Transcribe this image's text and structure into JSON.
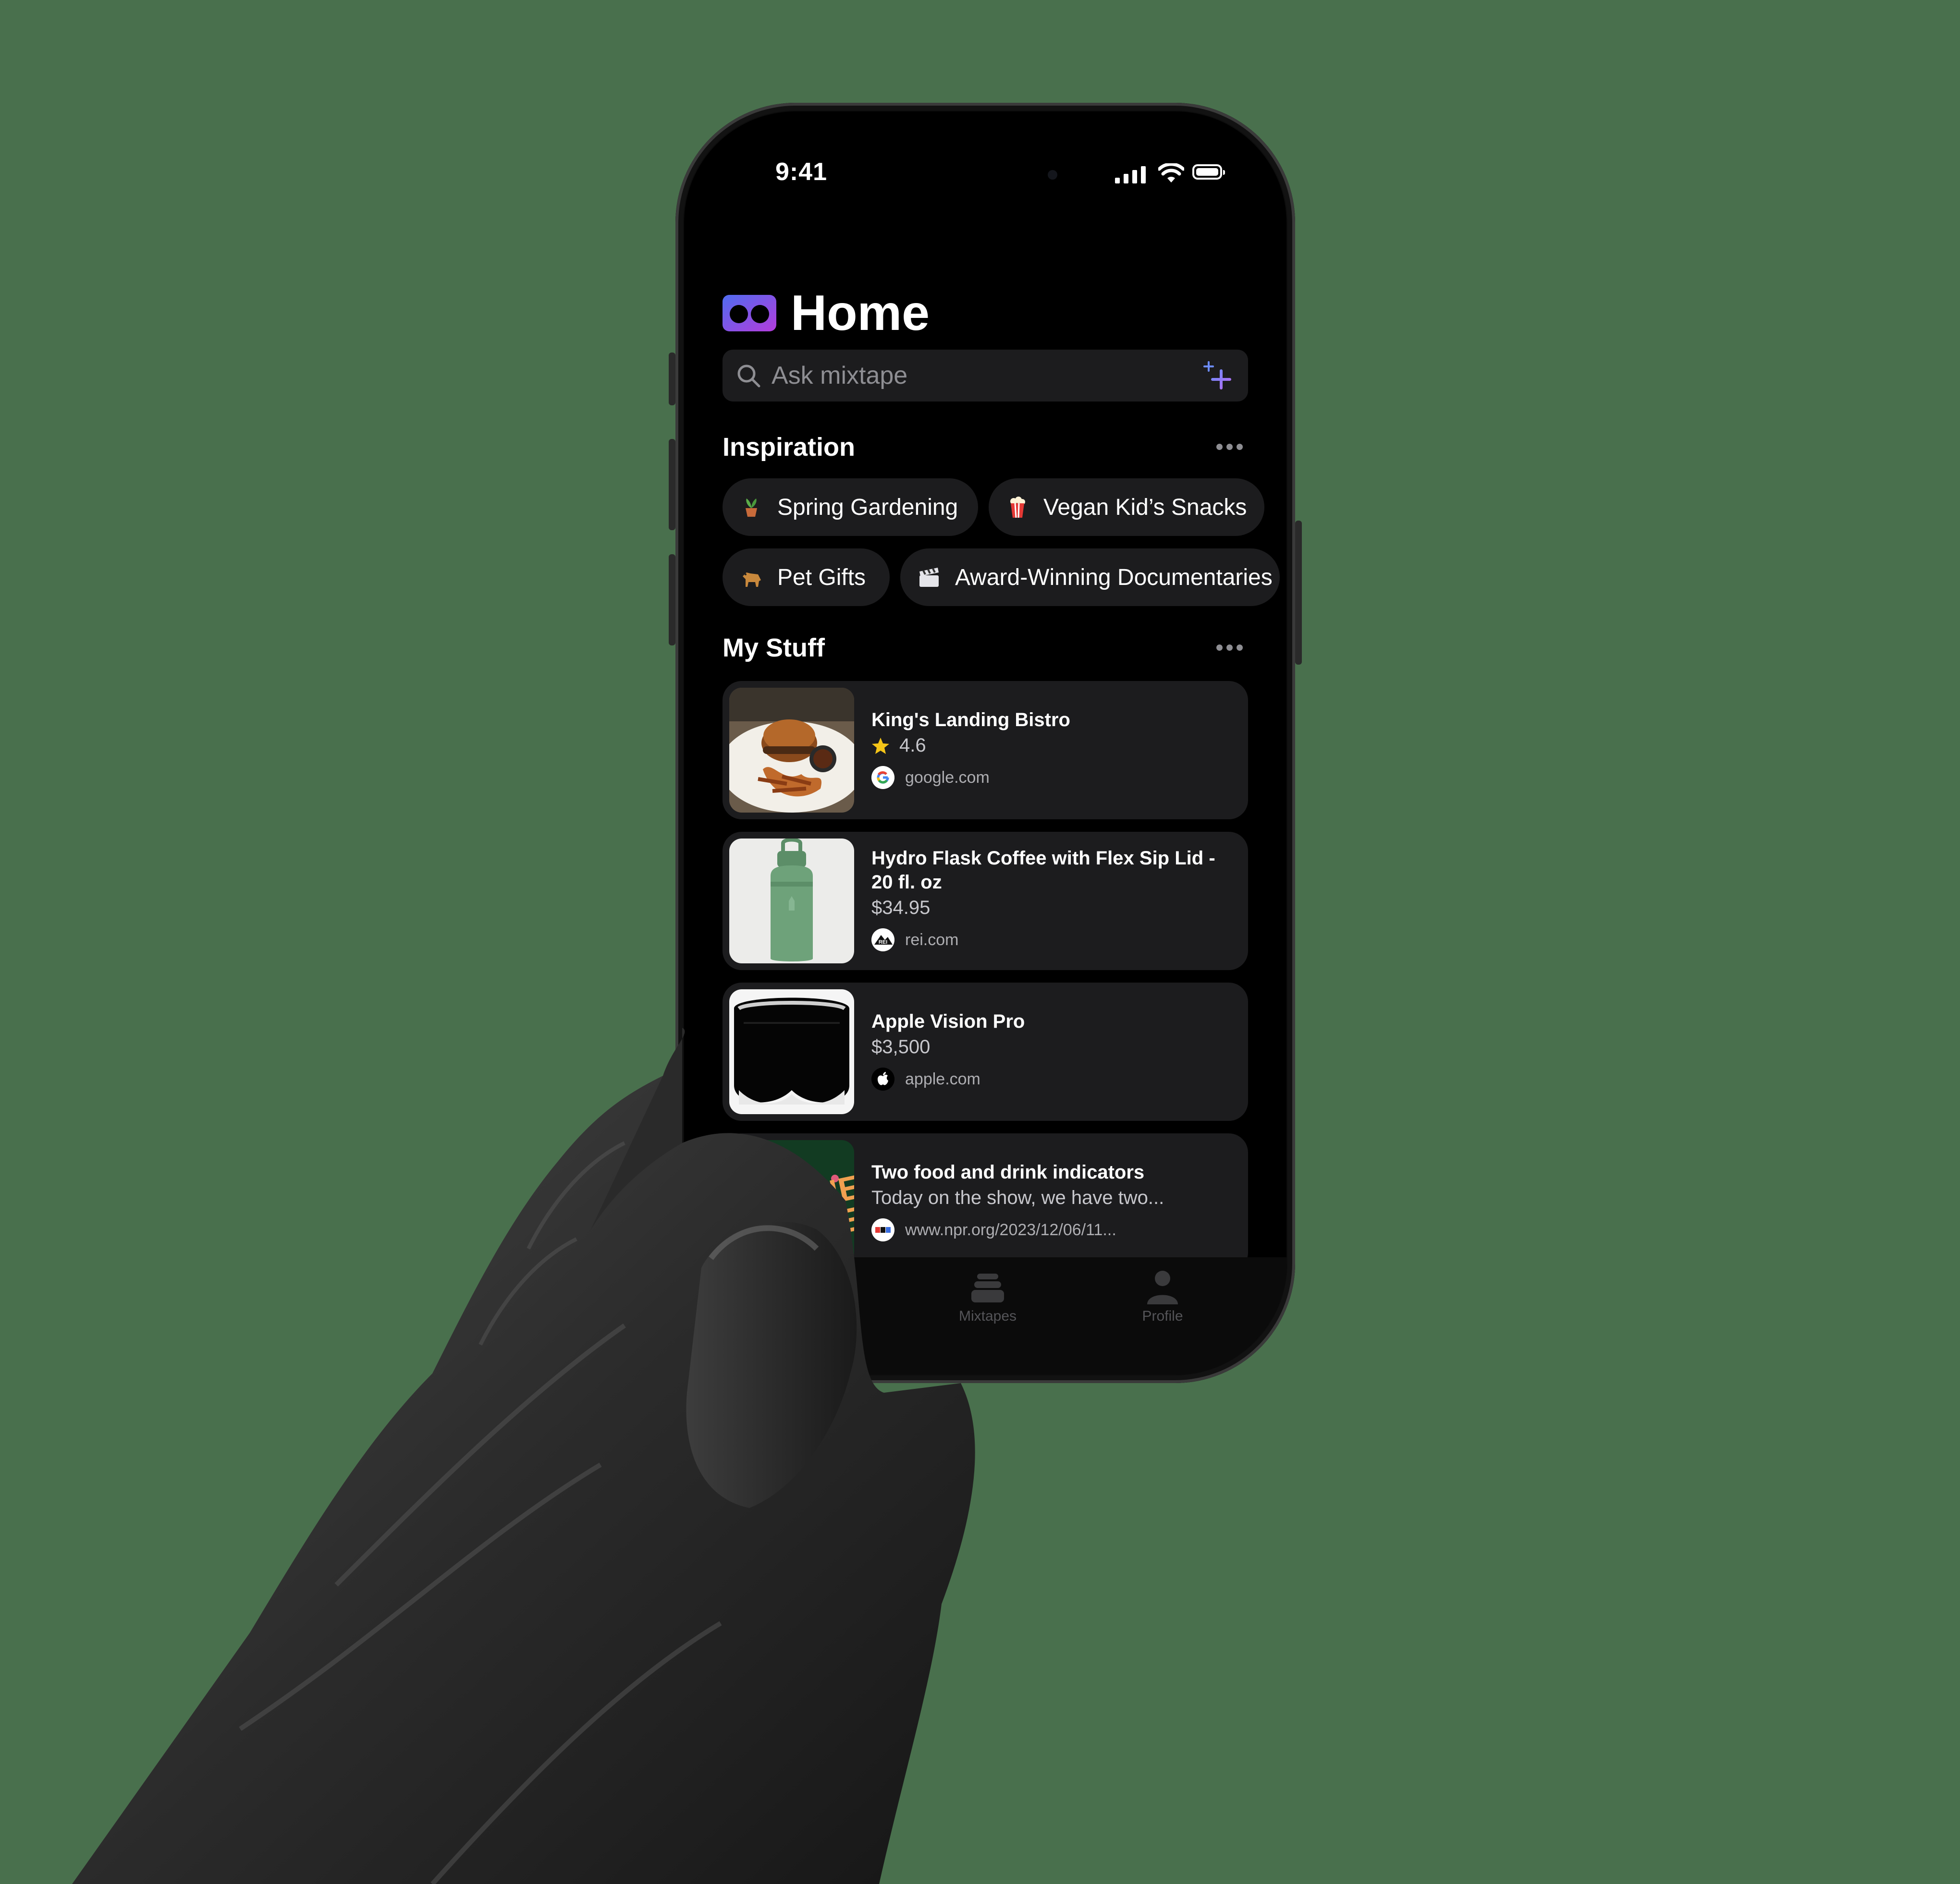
{
  "colors": {
    "background": "#49704d",
    "screen": "#000000",
    "surface": "#1c1c1e",
    "text_primary": "#ffffff",
    "text_secondary": "#8e8e93",
    "logo_gradient": [
      "#4f6cf0",
      "#b43cdc"
    ],
    "play_button": "#e53935",
    "star": "#f5c518"
  },
  "status_bar": {
    "time": "9:41",
    "icons": [
      "cellular-icon",
      "wifi-icon",
      "battery-icon"
    ]
  },
  "header": {
    "title": "Home",
    "logo_icon": "mixtape-logo-icon"
  },
  "search": {
    "placeholder": "Ask mixtape",
    "icon": "search-icon",
    "action_icon": "sparkle-icon"
  },
  "inspiration": {
    "title": "Inspiration",
    "more_icon": "ellipsis-icon",
    "chips": [
      {
        "label": "Spring Gardening",
        "icon": "potted-plant-icon"
      },
      {
        "label": "Vegan Kid’s Snacks",
        "icon": "popcorn-icon"
      },
      {
        "label": "Pet Gifts",
        "icon": "dog-icon"
      },
      {
        "label": "Award-Winning Documentaries",
        "icon": "clapperboard-icon"
      }
    ]
  },
  "my_stuff": {
    "title": "My Stuff",
    "more_icon": "ellipsis-icon",
    "items": [
      {
        "title": "King's Landing Bistro",
        "detail": "4.6",
        "detail_icon": "star-icon",
        "source": "google.com",
        "source_icon": "google-icon",
        "thumb": "burger-photo"
      },
      {
        "title": "Hydro Flask Coffee with Flex Sip Lid - 20 fl. oz",
        "detail": "$34.95",
        "source": "rei.com",
        "source_icon": "rei-icon",
        "thumb": "water-bottle-photo"
      },
      {
        "title": "Apple Vision Pro",
        "detail": "$3,500",
        "source": "apple.com",
        "source_icon": "apple-icon",
        "thumb": "vision-pro-photo"
      },
      {
        "title": "Two food and drink indicators",
        "detail": "Today on the show, we have two...",
        "source": "www.npr.org/2023/12/06/11...",
        "source_icon": "npr-icon",
        "thumb": "planet-money-podcast-art"
      }
    ]
  },
  "tab_bar": {
    "tabs": [
      {
        "label": "Mixtapes",
        "icon": "stack-icon"
      },
      {
        "label": "Profile",
        "icon": "person-icon"
      }
    ]
  }
}
